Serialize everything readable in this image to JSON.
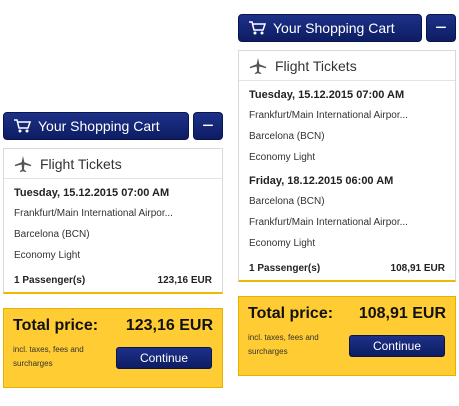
{
  "cart_title": "Your Shopping Cart",
  "collapse_label": "−",
  "section_title": "Flight Tickets",
  "icons": {
    "cart": "shopping-cart-icon",
    "plane": "airplane-icon"
  },
  "colors": {
    "header_blue": "#13267a",
    "total_yellow": "#ffcc33",
    "accent_border": "#f0b800"
  },
  "left": {
    "flights": [
      {
        "date": "Tuesday, 15.12.2015 07:00 AM",
        "from": "Frankfurt/Main International Airpor...",
        "to": "Barcelona (BCN)",
        "fare": "Economy Light"
      }
    ],
    "passengers": "1 Passenger(s)",
    "subtotal": "123,16 EUR",
    "total_label": "Total price:",
    "total_value": "123,16 EUR",
    "tax_note": "incl. taxes, fees and surcharges",
    "continue_label": "Continue"
  },
  "right": {
    "flights": [
      {
        "date": "Tuesday, 15.12.2015 07:00 AM",
        "from": "Frankfurt/Main International Airpor...",
        "to": "Barcelona (BCN)",
        "fare": "Economy Light"
      },
      {
        "date": "Friday, 18.12.2015 06:00 AM",
        "from": "Barcelona (BCN)",
        "to": "Frankfurt/Main International Airpor...",
        "fare": "Economy Light"
      }
    ],
    "passengers": "1 Passenger(s)",
    "subtotal": "108,91 EUR",
    "total_label": "Total price:",
    "total_value": "108,91 EUR",
    "tax_note": "incl. taxes, fees and surcharges",
    "continue_label": "Continue"
  }
}
